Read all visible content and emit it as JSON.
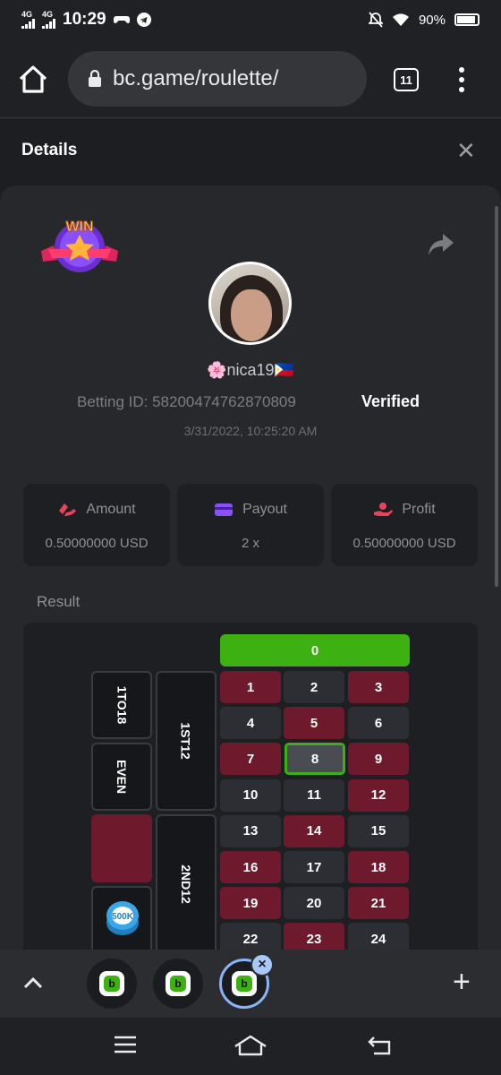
{
  "status_bar": {
    "network1": "4G",
    "network2": "4G",
    "time": "10:29",
    "battery": "90%"
  },
  "browser": {
    "url": "bc.game/roulette/",
    "tab_count": "11"
  },
  "details": {
    "title": "Details",
    "close_icon": "close-icon"
  },
  "bet": {
    "badge_text": "WIN",
    "username": "🌸nica19🇵🇭",
    "betting_id": "Betting ID: 58200474762870809",
    "verified": "Verified",
    "timestamp": "3/31/2022, 10:25:20 AM",
    "stats": [
      {
        "label": "Amount",
        "value": "0.50000000 USD",
        "icon": "amount-icon",
        "color": "#e9425a"
      },
      {
        "label": "Payout",
        "value": "2 x",
        "icon": "payout-card-icon",
        "color": "#8a4fff"
      },
      {
        "label": "Profit",
        "value": "0.50000000 USD",
        "icon": "profit-icon",
        "color": "#e9425a"
      }
    ]
  },
  "result": {
    "label": "Result",
    "zero": "0",
    "numbers": [
      "1",
      "2",
      "3",
      "4",
      "5",
      "6",
      "7",
      "8",
      "9",
      "10",
      "11",
      "12",
      "13",
      "14",
      "15",
      "16",
      "17",
      "18",
      "19",
      "20",
      "21",
      "22",
      "23",
      "24"
    ],
    "red_numbers": [
      "1",
      "3",
      "5",
      "7",
      "9",
      "12",
      "14",
      "16",
      "18",
      "19",
      "21",
      "23"
    ],
    "winning_number": "8",
    "side_bets": {
      "low": "1TO18",
      "even": "EVEN",
      "dozen1": "1ST12",
      "dozen2": "2ND12"
    },
    "chip_value": "500K",
    "colors": {
      "red": "#6e1a2c",
      "black": "#2d2e33",
      "green": "#3db012"
    }
  },
  "tab_group": {
    "tabs": [
      "bc-game-tab",
      "bc-game-tab",
      "bc-game-tab-active"
    ],
    "add_label": "+"
  }
}
